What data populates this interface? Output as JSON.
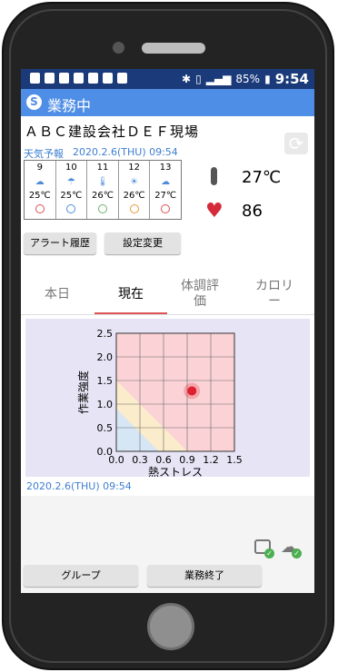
{
  "status_bar": {
    "battery": "85%",
    "time": "9:54"
  },
  "app_bar": {
    "logo": "S",
    "title": "業務中"
  },
  "site": {
    "name": "ＡＢＣ建設会社ＤＥＦ現場"
  },
  "forecast": {
    "label": "天気予報",
    "timestamp": "2020.2.6(THU) 09:54",
    "days": [
      {
        "day": "9",
        "weather": "cloud-icon",
        "temp": "25℃",
        "face": "red"
      },
      {
        "day": "10",
        "weather": "umbrella-icon",
        "temp": "25℃",
        "face": "blue"
      },
      {
        "day": "11",
        "weather": "thermometer-icon",
        "temp": "26℃",
        "face": "green"
      },
      {
        "day": "12",
        "weather": "sun-icon",
        "temp": "26℃",
        "face": "orange"
      },
      {
        "day": "13",
        "weather": "cloud-icon",
        "temp": "27℃",
        "face": "red"
      }
    ]
  },
  "vitals": {
    "temperature": "27℃",
    "heart_rate": "86"
  },
  "buttons": {
    "alert_history": "アラート履歴",
    "settings_change": "設定変更",
    "group": "グループ",
    "end_work": "業務終了"
  },
  "tabs": [
    {
      "label": "本日",
      "active": false
    },
    {
      "label": "現在",
      "active": true
    },
    {
      "label": "体調評価",
      "active": false
    },
    {
      "label": "カロリー",
      "active": false
    }
  ],
  "chart_data": {
    "type": "scatter",
    "xlabel": "熱ストレス",
    "ylabel": "作業強度",
    "xlim": [
      0.0,
      1.5
    ],
    "ylim": [
      0.0,
      2.5
    ],
    "xticks": [
      "0.0",
      "0.3",
      "0.6",
      "0.9",
      "1.2",
      "1.5"
    ],
    "yticks": [
      "0.0",
      "0.5",
      "1.0",
      "1.5",
      "2.0",
      "2.5"
    ],
    "grid": true,
    "zones": [
      {
        "name": "blue",
        "color": "#d6e6f5"
      },
      {
        "name": "yellow",
        "color": "#fbeccb"
      },
      {
        "name": "red",
        "color": "#fbd3d6"
      }
    ],
    "points": [
      {
        "x": 0.96,
        "y": 1.28,
        "color": "#e02030"
      }
    ]
  },
  "chart_timestamp": "2020.2.6(THU) 09:54"
}
